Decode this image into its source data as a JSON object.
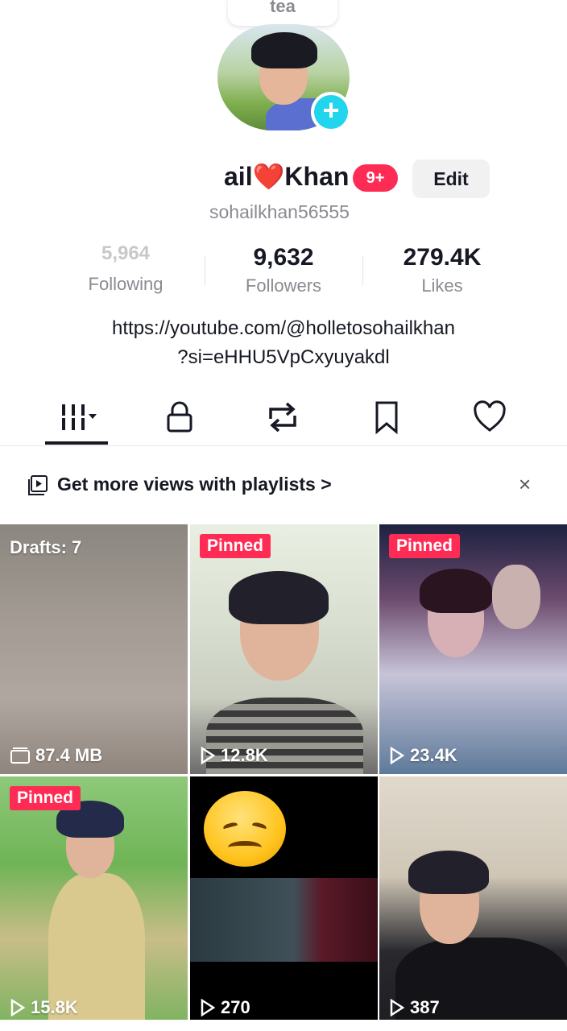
{
  "note": {
    "text": "tea"
  },
  "profile": {
    "name_partial": "ail",
    "name_heart": "❤️",
    "name_last": "Khan",
    "notif_badge": "9+",
    "edit_label": "Edit",
    "username": "sohailkhan56555"
  },
  "stats": {
    "following": {
      "value": "5,964",
      "label": "Following"
    },
    "followers": {
      "value": "9,632",
      "label": "Followers"
    },
    "likes": {
      "value": "279.4K",
      "label": "Likes"
    }
  },
  "bio": {
    "line1": "https://youtube.com/@holletosohailkhan",
    "line2": "?si=eHHU5VpCxyuyakdl"
  },
  "tabs": [
    "videos-grid",
    "private",
    "reposts",
    "saved",
    "liked"
  ],
  "banner": {
    "text": "Get more views with playlists >",
    "close": "×"
  },
  "grid": [
    {
      "top_label": "Drafts: 7",
      "bottom_label": "87.4 MB",
      "bottom_icon": "folder-icon"
    },
    {
      "pinned": "Pinned",
      "views": "12.8K"
    },
    {
      "pinned": "Pinned",
      "views": "23.4K"
    },
    {
      "pinned": "Pinned",
      "views": "15.8K"
    },
    {
      "views": "270"
    },
    {
      "views": "387"
    }
  ],
  "colors": {
    "accent": "#fe2c55",
    "add_badge": "#20d5ec",
    "text_secondary": "#8a8b91"
  }
}
